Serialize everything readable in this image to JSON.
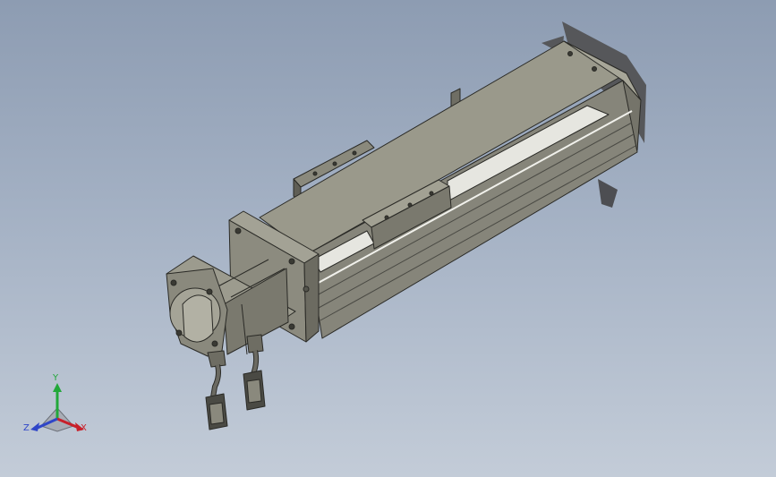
{
  "viewport": {
    "background_top": "#8d9cb2",
    "background_bottom": "#c3ccd8"
  },
  "model": {
    "body_color": "#8b8a7d",
    "edge_color": "#2a2a26",
    "highlight_color": "#e6e6e0"
  },
  "triad": {
    "x_label": "X",
    "y_label": "Y",
    "z_label": "Z",
    "x_color": "#c8202a",
    "y_color": "#22a83a",
    "z_color": "#2f46c8"
  }
}
